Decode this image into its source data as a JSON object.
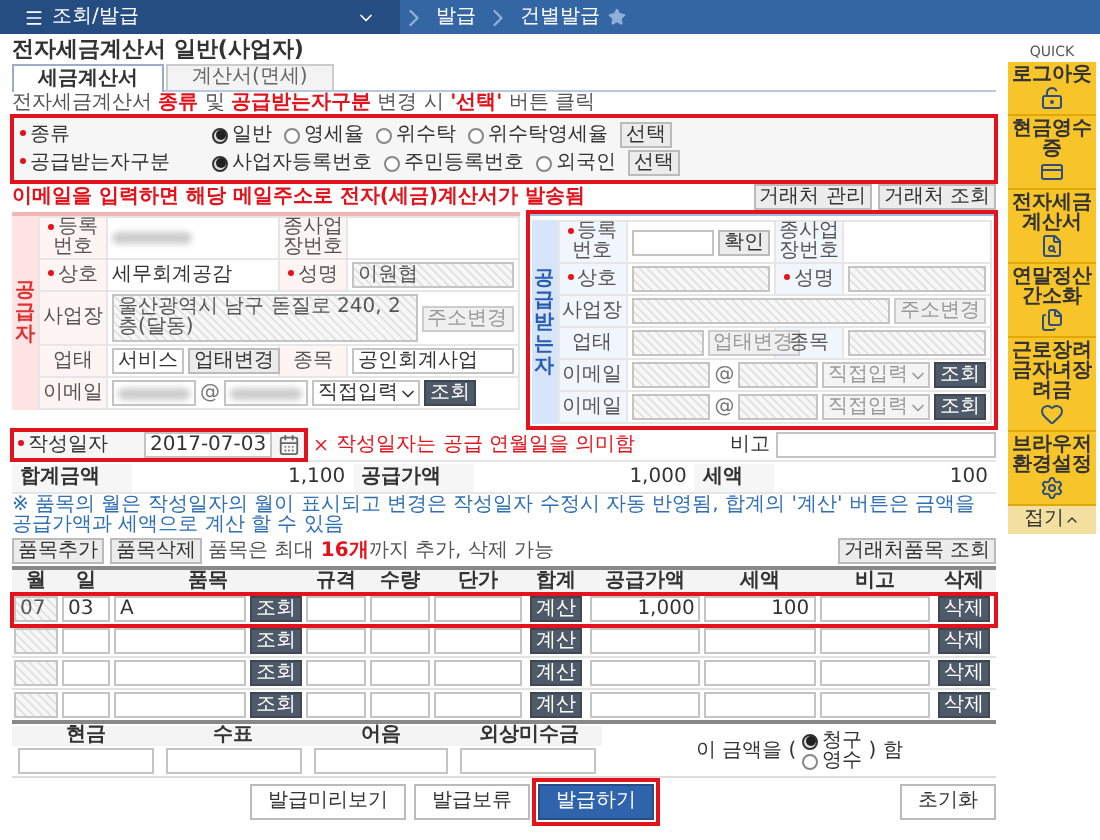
{
  "nav": {
    "menu": "조회/발급",
    "crumbs": [
      "발급",
      "건별발급"
    ]
  },
  "title": "전자세금계산서 일반(사업자)",
  "tabs": [
    {
      "label": "세금계산서",
      "selected": true
    },
    {
      "label": "계산서(면세)",
      "selected": false
    }
  ],
  "notice": "전자세금계산서 **종류** 및 **공급받는자구분** 변경 시 **'선택'** 버튼 클릭",
  "selector_bar": {
    "highlighted": true,
    "groups": [
      {
        "label": "종류",
        "required": true,
        "button": "선택",
        "options": [
          {
            "label": "일반",
            "selected": true
          },
          {
            "label": "영세율",
            "selected": false
          },
          {
            "label": "위수탁",
            "selected": false
          },
          {
            "label": "위수탁영세율",
            "selected": false
          }
        ]
      },
      {
        "label": "공급받는자구분",
        "required": true,
        "button": "선택",
        "options": [
          {
            "label": "사업자등록번호",
            "selected": true
          },
          {
            "label": "주민등록번호",
            "selected": false
          },
          {
            "label": "외국인",
            "selected": false
          }
        ]
      }
    ]
  },
  "email_note": "이메일을 입력하면 해당 메일주소로 전자(세금)계산서가 발송됨",
  "party_buttons": [
    "거래처 관리",
    "거래처 조회"
  ],
  "parties": [
    {
      "title": "공급자",
      "highlighted": false,
      "rows": [
        [
          {
            "label": "등록번호",
            "required": true,
            "kind": "redacted"
          },
          {
            "label": "종사업장번호",
            "required": false,
            "kind": "empty"
          }
        ],
        [
          {
            "label": "상호",
            "required": true,
            "kind": "text",
            "value": "세무회계공감"
          },
          {
            "label": "성명",
            "required": true,
            "kind": "input",
            "value": "이원협",
            "disabled": true
          }
        ],
        [
          {
            "label": "사업장",
            "required": false,
            "kind": "input",
            "value": "울산광역시 남구 돋질로 240, 2층(달동)",
            "disabled": true,
            "button": {
              "label": "주소변경",
              "disabled": true
            }
          }
        ],
        [
          {
            "label": "업태",
            "required": false,
            "kind": "input",
            "value": "서비스",
            "disabled": false,
            "button": {
              "label": "업태변경",
              "disabled": false
            }
          },
          {
            "label": "종목",
            "required": false,
            "kind": "input",
            "value": "공인회계사업",
            "disabled": false
          }
        ],
        [
          {
            "label": "이메일",
            "required": false,
            "kind": "email",
            "redacted": true,
            "disabled": false,
            "at": "@",
            "domain": "직접입력",
            "button": "조회"
          }
        ]
      ]
    },
    {
      "title": "공급받는자",
      "highlighted": true,
      "rows": [
        [
          {
            "label": "등록번호",
            "required": true,
            "kind": "input",
            "disabled": false,
            "button": {
              "label": "확인",
              "disabled": false
            }
          },
          {
            "label": "종사업장번호",
            "required": false,
            "kind": "empty"
          }
        ],
        [
          {
            "label": "상호",
            "required": true,
            "kind": "input",
            "disabled": true
          },
          {
            "label": "성명",
            "required": true,
            "kind": "input",
            "disabled": true
          }
        ],
        [
          {
            "label": "사업장",
            "required": false,
            "kind": "input",
            "disabled": true,
            "button": {
              "label": "주소변경",
              "disabled": true
            }
          }
        ],
        [
          {
            "label": "업태",
            "required": false,
            "kind": "input",
            "disabled": true,
            "button": {
              "label": "업태변경",
              "disabled": true
            }
          },
          {
            "label": "종목",
            "required": false,
            "kind": "input",
            "disabled": true
          }
        ],
        [
          {
            "label": "이메일",
            "required": false,
            "kind": "email",
            "redacted": false,
            "disabled": true,
            "at": "@",
            "domain": "직접입력",
            "button": "조회"
          }
        ],
        [
          {
            "label": "이메일",
            "required": false,
            "kind": "email",
            "redacted": false,
            "disabled": true,
            "at": "@",
            "domain": "직접입력",
            "button": "조회"
          }
        ]
      ]
    }
  ],
  "write_date": {
    "label": "작성일자",
    "required": true,
    "value": "2017-07-03",
    "hint": "작성일자는 공급 연월일을 의미함",
    "highlighted": true
  },
  "memo": {
    "label": "비고"
  },
  "totals": [
    {
      "label": "합계금액",
      "value": "1,100"
    },
    {
      "label": "공급가액",
      "value": "1,000"
    },
    {
      "label": "세액",
      "value": "100"
    }
  ],
  "item_note": "※ 품목의 월은 작성일자의 월이 표시되고 변경은 작성일자 수정시 자동 반영됨, 합계의 '계산' 버튼은 금액을 공급가액과 세액으로 계산 할 수 있음",
  "item_buttons": [
    "품목추가",
    "품목삭제"
  ],
  "item_limit": "품목은 최대 **16개**까지 추가, 삭제 가능",
  "item_lookup": "거래처품목 조회",
  "columns": [
    "월",
    "일",
    "품목",
    "규격",
    "수량",
    "단가",
    "합계",
    "공급가액",
    "세액",
    "비고",
    "삭제"
  ],
  "items": [
    {
      "month": "07",
      "day": "03",
      "name": "A",
      "supply": "1,000",
      "tax": "100",
      "lookup": "조회",
      "calc": "계산",
      "delete": "삭제",
      "highlighted": true
    },
    {
      "lookup": "조회",
      "calc": "계산",
      "delete": "삭제",
      "highlighted": false
    },
    {
      "lookup": "조회",
      "calc": "계산",
      "delete": "삭제",
      "highlighted": false
    },
    {
      "lookup": "조회",
      "calc": "계산",
      "delete": "삭제",
      "highlighted": false
    }
  ],
  "payment": {
    "columns": [
      "현금",
      "수표",
      "어음",
      "외상미수금"
    ],
    "prefix": "이 금액을 (",
    "options": [
      {
        "label": "청구",
        "selected": true
      },
      {
        "label": "영수",
        "selected": false
      }
    ],
    "suffix": ") 함"
  },
  "actions": [
    {
      "label": "발급미리보기",
      "primary": false,
      "highlighted": false
    },
    {
      "label": "발급보류",
      "primary": false,
      "highlighted": false
    },
    {
      "label": "발급하기",
      "primary": true,
      "highlighted": true
    }
  ],
  "reset": "초기화",
  "quick": {
    "title": "QUICK",
    "items": [
      {
        "label": "로그아웃",
        "kind": "logout"
      },
      {
        "label": "현금영수증",
        "kind": "receipt"
      },
      {
        "label": "전자세금계산서",
        "kind": "invoice"
      },
      {
        "label": "연말정산간소화",
        "kind": "yearend"
      },
      {
        "label": "근로장려금자녀장려금",
        "kind": "incentive"
      },
      {
        "label": "브라우저환경설정",
        "kind": "settings"
      }
    ],
    "collapse": "접기"
  }
}
